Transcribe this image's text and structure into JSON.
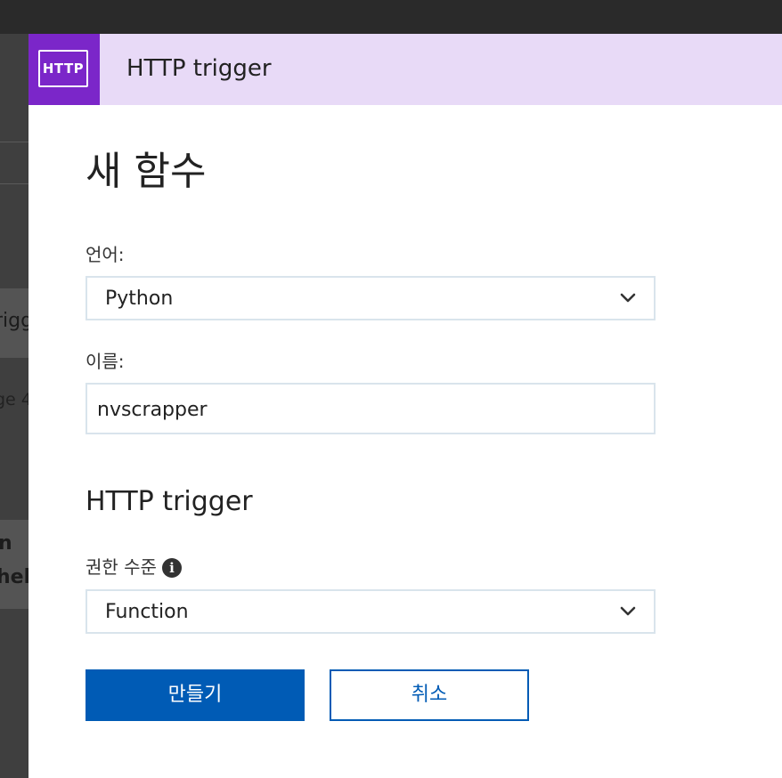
{
  "panel": {
    "header_title": "HTTP trigger",
    "badge_text": "HTTP",
    "title": "새 함수"
  },
  "form": {
    "language_label": "언어:",
    "language_value": "Python",
    "name_label": "이름:",
    "name_value": "nvscrapper",
    "trigger_section_title": "HTTP trigger",
    "auth_level_label": "권한 수준",
    "auth_level_value": "Function"
  },
  "buttons": {
    "create_label": "만들기",
    "cancel_label": "취소"
  },
  "background": {
    "fragment_1": "rigge",
    "fragment_2": "ge 4",
    "fragment_3": "n",
    "fragment_4": "hel"
  },
  "colors": {
    "accent": "#005bb5",
    "badge_purple": "#7b26c9",
    "header_bg": "#e8daf7"
  },
  "icons": {
    "info": "info-icon",
    "chevron": "chevron-down-icon"
  }
}
